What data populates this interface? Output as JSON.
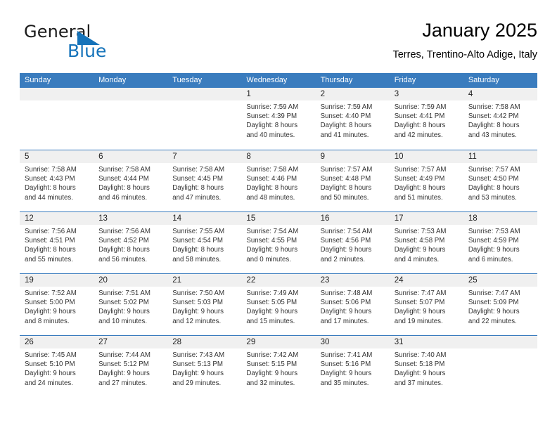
{
  "brand": {
    "name_top": "General",
    "name_bottom": "Blue",
    "accent_color": "#1573ba",
    "triangle_icon": "triangle-icon"
  },
  "header": {
    "title": "January 2025",
    "subtitle": "Terres, Trentino-Alto Adige, Italy"
  },
  "calendar": {
    "header_bg": "#3a7cbe",
    "daynum_band_bg": "#f0f0f0",
    "weekdays": [
      "Sunday",
      "Monday",
      "Tuesday",
      "Wednesday",
      "Thursday",
      "Friday",
      "Saturday"
    ],
    "weeks": [
      [
        {
          "day": "",
          "lines": []
        },
        {
          "day": "",
          "lines": []
        },
        {
          "day": "",
          "lines": []
        },
        {
          "day": "1",
          "lines": [
            "Sunrise: 7:59 AM",
            "Sunset: 4:39 PM",
            "Daylight: 8 hours",
            "and 40 minutes."
          ]
        },
        {
          "day": "2",
          "lines": [
            "Sunrise: 7:59 AM",
            "Sunset: 4:40 PM",
            "Daylight: 8 hours",
            "and 41 minutes."
          ]
        },
        {
          "day": "3",
          "lines": [
            "Sunrise: 7:59 AM",
            "Sunset: 4:41 PM",
            "Daylight: 8 hours",
            "and 42 minutes."
          ]
        },
        {
          "day": "4",
          "lines": [
            "Sunrise: 7:58 AM",
            "Sunset: 4:42 PM",
            "Daylight: 8 hours",
            "and 43 minutes."
          ]
        }
      ],
      [
        {
          "day": "5",
          "lines": [
            "Sunrise: 7:58 AM",
            "Sunset: 4:43 PM",
            "Daylight: 8 hours",
            "and 44 minutes."
          ]
        },
        {
          "day": "6",
          "lines": [
            "Sunrise: 7:58 AM",
            "Sunset: 4:44 PM",
            "Daylight: 8 hours",
            "and 46 minutes."
          ]
        },
        {
          "day": "7",
          "lines": [
            "Sunrise: 7:58 AM",
            "Sunset: 4:45 PM",
            "Daylight: 8 hours",
            "and 47 minutes."
          ]
        },
        {
          "day": "8",
          "lines": [
            "Sunrise: 7:58 AM",
            "Sunset: 4:46 PM",
            "Daylight: 8 hours",
            "and 48 minutes."
          ]
        },
        {
          "day": "9",
          "lines": [
            "Sunrise: 7:57 AM",
            "Sunset: 4:48 PM",
            "Daylight: 8 hours",
            "and 50 minutes."
          ]
        },
        {
          "day": "10",
          "lines": [
            "Sunrise: 7:57 AM",
            "Sunset: 4:49 PM",
            "Daylight: 8 hours",
            "and 51 minutes."
          ]
        },
        {
          "day": "11",
          "lines": [
            "Sunrise: 7:57 AM",
            "Sunset: 4:50 PM",
            "Daylight: 8 hours",
            "and 53 minutes."
          ]
        }
      ],
      [
        {
          "day": "12",
          "lines": [
            "Sunrise: 7:56 AM",
            "Sunset: 4:51 PM",
            "Daylight: 8 hours",
            "and 55 minutes."
          ]
        },
        {
          "day": "13",
          "lines": [
            "Sunrise: 7:56 AM",
            "Sunset: 4:52 PM",
            "Daylight: 8 hours",
            "and 56 minutes."
          ]
        },
        {
          "day": "14",
          "lines": [
            "Sunrise: 7:55 AM",
            "Sunset: 4:54 PM",
            "Daylight: 8 hours",
            "and 58 minutes."
          ]
        },
        {
          "day": "15",
          "lines": [
            "Sunrise: 7:54 AM",
            "Sunset: 4:55 PM",
            "Daylight: 9 hours",
            "and 0 minutes."
          ]
        },
        {
          "day": "16",
          "lines": [
            "Sunrise: 7:54 AM",
            "Sunset: 4:56 PM",
            "Daylight: 9 hours",
            "and 2 minutes."
          ]
        },
        {
          "day": "17",
          "lines": [
            "Sunrise: 7:53 AM",
            "Sunset: 4:58 PM",
            "Daylight: 9 hours",
            "and 4 minutes."
          ]
        },
        {
          "day": "18",
          "lines": [
            "Sunrise: 7:53 AM",
            "Sunset: 4:59 PM",
            "Daylight: 9 hours",
            "and 6 minutes."
          ]
        }
      ],
      [
        {
          "day": "19",
          "lines": [
            "Sunrise: 7:52 AM",
            "Sunset: 5:00 PM",
            "Daylight: 9 hours",
            "and 8 minutes."
          ]
        },
        {
          "day": "20",
          "lines": [
            "Sunrise: 7:51 AM",
            "Sunset: 5:02 PM",
            "Daylight: 9 hours",
            "and 10 minutes."
          ]
        },
        {
          "day": "21",
          "lines": [
            "Sunrise: 7:50 AM",
            "Sunset: 5:03 PM",
            "Daylight: 9 hours",
            "and 12 minutes."
          ]
        },
        {
          "day": "22",
          "lines": [
            "Sunrise: 7:49 AM",
            "Sunset: 5:05 PM",
            "Daylight: 9 hours",
            "and 15 minutes."
          ]
        },
        {
          "day": "23",
          "lines": [
            "Sunrise: 7:48 AM",
            "Sunset: 5:06 PM",
            "Daylight: 9 hours",
            "and 17 minutes."
          ]
        },
        {
          "day": "24",
          "lines": [
            "Sunrise: 7:47 AM",
            "Sunset: 5:07 PM",
            "Daylight: 9 hours",
            "and 19 minutes."
          ]
        },
        {
          "day": "25",
          "lines": [
            "Sunrise: 7:47 AM",
            "Sunset: 5:09 PM",
            "Daylight: 9 hours",
            "and 22 minutes."
          ]
        }
      ],
      [
        {
          "day": "26",
          "lines": [
            "Sunrise: 7:45 AM",
            "Sunset: 5:10 PM",
            "Daylight: 9 hours",
            "and 24 minutes."
          ]
        },
        {
          "day": "27",
          "lines": [
            "Sunrise: 7:44 AM",
            "Sunset: 5:12 PM",
            "Daylight: 9 hours",
            "and 27 minutes."
          ]
        },
        {
          "day": "28",
          "lines": [
            "Sunrise: 7:43 AM",
            "Sunset: 5:13 PM",
            "Daylight: 9 hours",
            "and 29 minutes."
          ]
        },
        {
          "day": "29",
          "lines": [
            "Sunrise: 7:42 AM",
            "Sunset: 5:15 PM",
            "Daylight: 9 hours",
            "and 32 minutes."
          ]
        },
        {
          "day": "30",
          "lines": [
            "Sunrise: 7:41 AM",
            "Sunset: 5:16 PM",
            "Daylight: 9 hours",
            "and 35 minutes."
          ]
        },
        {
          "day": "31",
          "lines": [
            "Sunrise: 7:40 AM",
            "Sunset: 5:18 PM",
            "Daylight: 9 hours",
            "and 37 minutes."
          ]
        },
        {
          "day": "",
          "lines": []
        }
      ]
    ]
  }
}
